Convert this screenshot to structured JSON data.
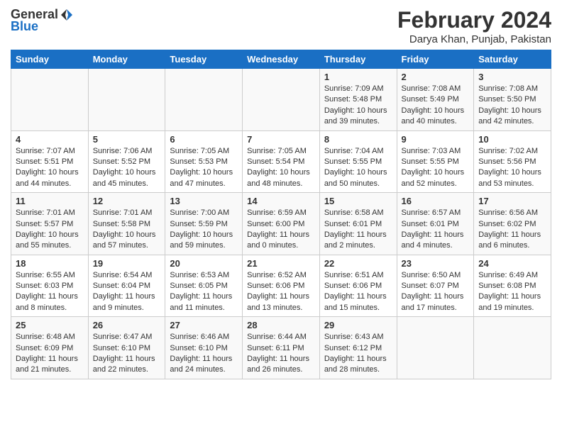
{
  "logo": {
    "general": "General",
    "blue": "Blue"
  },
  "title": {
    "month_year": "February 2024",
    "location": "Darya Khan, Punjab, Pakistan"
  },
  "headers": [
    "Sunday",
    "Monday",
    "Tuesday",
    "Wednesday",
    "Thursday",
    "Friday",
    "Saturday"
  ],
  "weeks": [
    [
      {
        "day": "",
        "info": ""
      },
      {
        "day": "",
        "info": ""
      },
      {
        "day": "",
        "info": ""
      },
      {
        "day": "",
        "info": ""
      },
      {
        "day": "1",
        "info": "Sunrise: 7:09 AM\nSunset: 5:48 PM\nDaylight: 10 hours\nand 39 minutes."
      },
      {
        "day": "2",
        "info": "Sunrise: 7:08 AM\nSunset: 5:49 PM\nDaylight: 10 hours\nand 40 minutes."
      },
      {
        "day": "3",
        "info": "Sunrise: 7:08 AM\nSunset: 5:50 PM\nDaylight: 10 hours\nand 42 minutes."
      }
    ],
    [
      {
        "day": "4",
        "info": "Sunrise: 7:07 AM\nSunset: 5:51 PM\nDaylight: 10 hours\nand 44 minutes."
      },
      {
        "day": "5",
        "info": "Sunrise: 7:06 AM\nSunset: 5:52 PM\nDaylight: 10 hours\nand 45 minutes."
      },
      {
        "day": "6",
        "info": "Sunrise: 7:05 AM\nSunset: 5:53 PM\nDaylight: 10 hours\nand 47 minutes."
      },
      {
        "day": "7",
        "info": "Sunrise: 7:05 AM\nSunset: 5:54 PM\nDaylight: 10 hours\nand 48 minutes."
      },
      {
        "day": "8",
        "info": "Sunrise: 7:04 AM\nSunset: 5:55 PM\nDaylight: 10 hours\nand 50 minutes."
      },
      {
        "day": "9",
        "info": "Sunrise: 7:03 AM\nSunset: 5:55 PM\nDaylight: 10 hours\nand 52 minutes."
      },
      {
        "day": "10",
        "info": "Sunrise: 7:02 AM\nSunset: 5:56 PM\nDaylight: 10 hours\nand 53 minutes."
      }
    ],
    [
      {
        "day": "11",
        "info": "Sunrise: 7:01 AM\nSunset: 5:57 PM\nDaylight: 10 hours\nand 55 minutes."
      },
      {
        "day": "12",
        "info": "Sunrise: 7:01 AM\nSunset: 5:58 PM\nDaylight: 10 hours\nand 57 minutes."
      },
      {
        "day": "13",
        "info": "Sunrise: 7:00 AM\nSunset: 5:59 PM\nDaylight: 10 hours\nand 59 minutes."
      },
      {
        "day": "14",
        "info": "Sunrise: 6:59 AM\nSunset: 6:00 PM\nDaylight: 11 hours\nand 0 minutes."
      },
      {
        "day": "15",
        "info": "Sunrise: 6:58 AM\nSunset: 6:01 PM\nDaylight: 11 hours\nand 2 minutes."
      },
      {
        "day": "16",
        "info": "Sunrise: 6:57 AM\nSunset: 6:01 PM\nDaylight: 11 hours\nand 4 minutes."
      },
      {
        "day": "17",
        "info": "Sunrise: 6:56 AM\nSunset: 6:02 PM\nDaylight: 11 hours\nand 6 minutes."
      }
    ],
    [
      {
        "day": "18",
        "info": "Sunrise: 6:55 AM\nSunset: 6:03 PM\nDaylight: 11 hours\nand 8 minutes."
      },
      {
        "day": "19",
        "info": "Sunrise: 6:54 AM\nSunset: 6:04 PM\nDaylight: 11 hours\nand 9 minutes."
      },
      {
        "day": "20",
        "info": "Sunrise: 6:53 AM\nSunset: 6:05 PM\nDaylight: 11 hours\nand 11 minutes."
      },
      {
        "day": "21",
        "info": "Sunrise: 6:52 AM\nSunset: 6:06 PM\nDaylight: 11 hours\nand 13 minutes."
      },
      {
        "day": "22",
        "info": "Sunrise: 6:51 AM\nSunset: 6:06 PM\nDaylight: 11 hours\nand 15 minutes."
      },
      {
        "day": "23",
        "info": "Sunrise: 6:50 AM\nSunset: 6:07 PM\nDaylight: 11 hours\nand 17 minutes."
      },
      {
        "day": "24",
        "info": "Sunrise: 6:49 AM\nSunset: 6:08 PM\nDaylight: 11 hours\nand 19 minutes."
      }
    ],
    [
      {
        "day": "25",
        "info": "Sunrise: 6:48 AM\nSunset: 6:09 PM\nDaylight: 11 hours\nand 21 minutes."
      },
      {
        "day": "26",
        "info": "Sunrise: 6:47 AM\nSunset: 6:10 PM\nDaylight: 11 hours\nand 22 minutes."
      },
      {
        "day": "27",
        "info": "Sunrise: 6:46 AM\nSunset: 6:10 PM\nDaylight: 11 hours\nand 24 minutes."
      },
      {
        "day": "28",
        "info": "Sunrise: 6:44 AM\nSunset: 6:11 PM\nDaylight: 11 hours\nand 26 minutes."
      },
      {
        "day": "29",
        "info": "Sunrise: 6:43 AM\nSunset: 6:12 PM\nDaylight: 11 hours\nand 28 minutes."
      },
      {
        "day": "",
        "info": ""
      },
      {
        "day": "",
        "info": ""
      }
    ]
  ]
}
